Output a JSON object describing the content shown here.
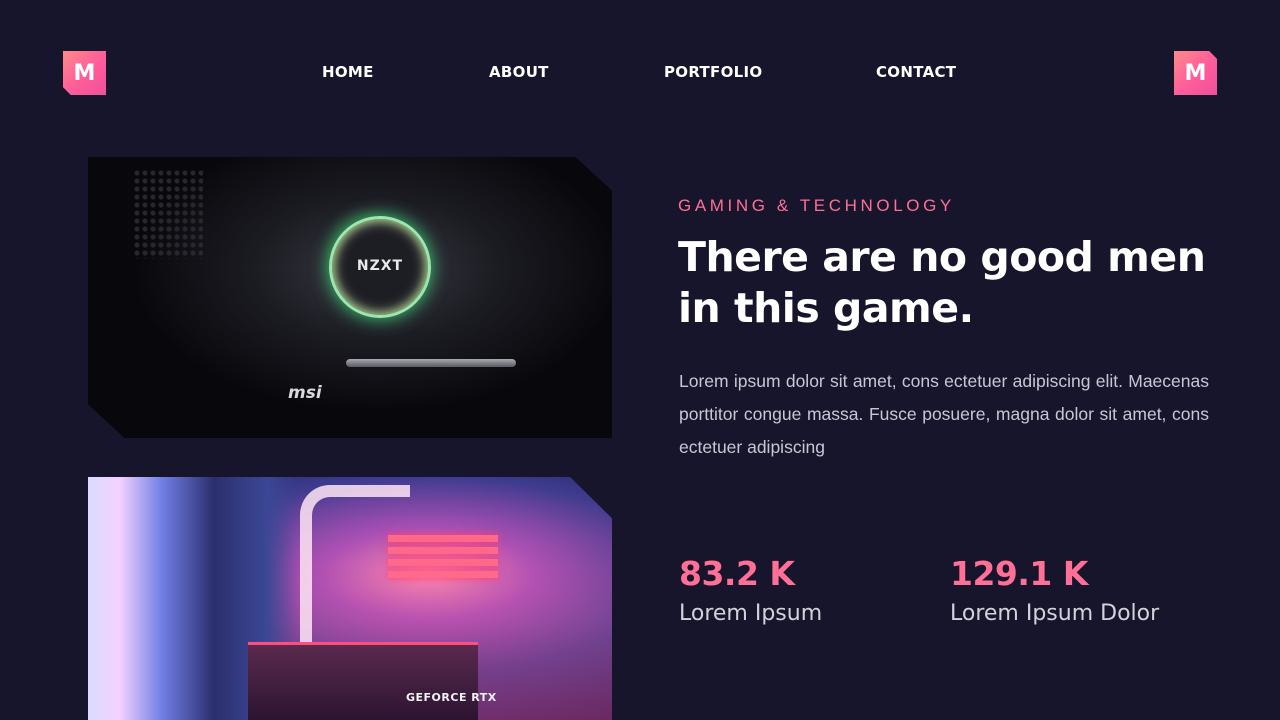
{
  "brand": {
    "logo_letter": "M",
    "accent_color": "#ff6f96",
    "background_color": "#17152b"
  },
  "nav": {
    "items": [
      {
        "label": "HOME"
      },
      {
        "label": "ABOUT"
      },
      {
        "label": "PORTFOLIO"
      },
      {
        "label": "CONTACT"
      }
    ]
  },
  "photos": {
    "top": {
      "cooler_brand": "NZXT",
      "gpu_brand": "msi"
    },
    "bottom": {
      "gpu_brand": "GEFORCE RTX"
    }
  },
  "hero": {
    "eyebrow": "GAMING & TECHNOLOGY",
    "headline": "There are no good men in this game.",
    "body": "Lorem ipsum dolor sit amet, cons ectetuer adipiscing elit. Maecenas porttitor congue massa. Fusce posuere, magna dolor sit amet, cons ectetuer adipiscing"
  },
  "stats": [
    {
      "value": "83.2 K",
      "label": "Lorem Ipsum"
    },
    {
      "value": "129.1 K",
      "label": "Lorem Ipsum Dolor"
    }
  ]
}
